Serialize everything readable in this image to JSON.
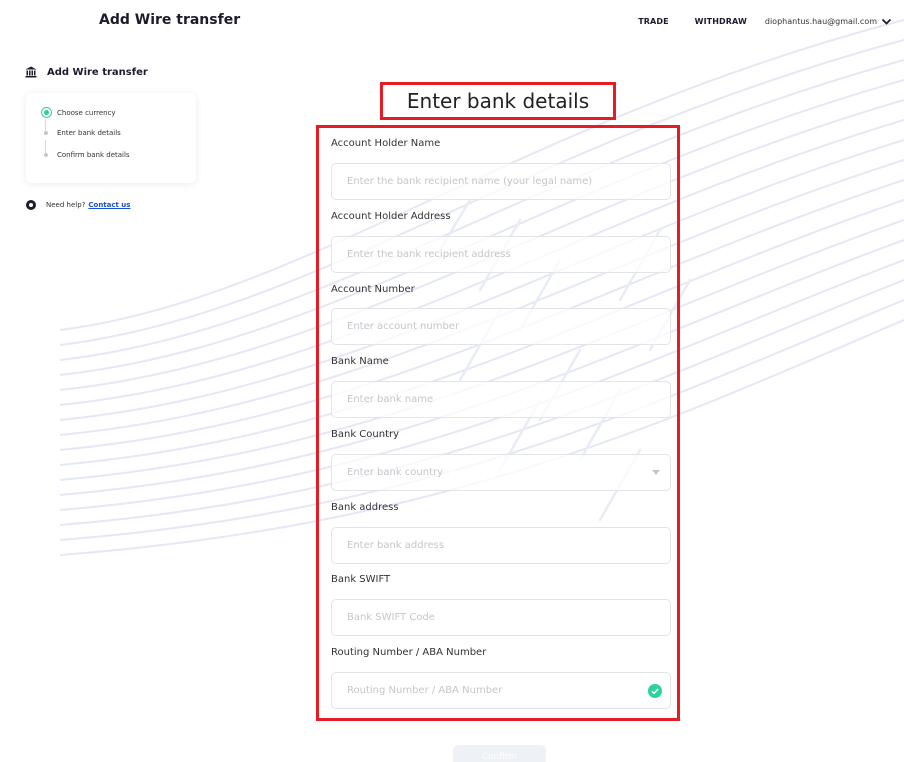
{
  "header": {
    "title": "Add Wire transfer"
  },
  "nav": {
    "trade": "TRADE",
    "withdraw": "WITHDRAW",
    "user_email": "diophantus.hau@gmail.com"
  },
  "sidebar": {
    "title": "Add Wire transfer",
    "steps": [
      {
        "label": "Choose currency",
        "state": "active"
      },
      {
        "label": "Enter bank details",
        "state": "pending"
      },
      {
        "label": "Confirm bank details",
        "state": "pending"
      }
    ],
    "help_text": "Need help?",
    "contact_label": "Contact us"
  },
  "form": {
    "heading": "Enter bank details",
    "fields": [
      {
        "label": "Account Holder Name",
        "placeholder": "Enter the bank recipient name (your legal name)"
      },
      {
        "label": "Account Holder Address",
        "placeholder": "Enter the bank recipient address"
      },
      {
        "label": "Account Number",
        "placeholder": "Enter account number"
      },
      {
        "label": "Bank Name",
        "placeholder": "Enter bank name"
      },
      {
        "label": "Bank Country",
        "placeholder": "Enter bank country"
      },
      {
        "label": "Bank address",
        "placeholder": "Enter bank address"
      },
      {
        "label": "Bank SWIFT",
        "placeholder": "Bank SWIFT Code"
      },
      {
        "label": "Routing Number / ABA Number",
        "placeholder": "Routing Number / ABA Number"
      }
    ],
    "submit_label": "Confirm"
  },
  "icons": {
    "bank": "bank-icon",
    "help": "help-icon",
    "dropdown": "chevron-down-icon",
    "valid": "check-circle-icon"
  },
  "colors": {
    "accent_green": "#2dd29a",
    "highlight_red": "#e41c23",
    "link_blue": "#1a4fd8"
  }
}
